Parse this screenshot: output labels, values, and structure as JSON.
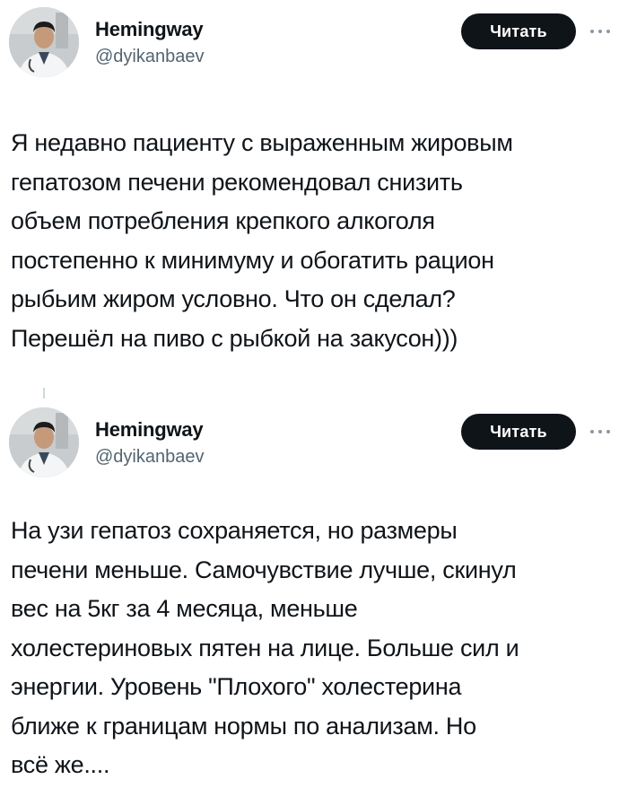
{
  "colors": {
    "text_primary": "#0f1419",
    "text_secondary": "#536471",
    "button_bg": "#0f1419",
    "button_text": "#ffffff",
    "thread_line": "#cfd9de"
  },
  "tweets": [
    {
      "author": {
        "name": "Hemingway",
        "handle": "@dyikanbaev",
        "avatar_icon": "doctor-profile-photo"
      },
      "follow_label": "Читать",
      "more_icon": "ellipsis-icon",
      "text": "Я недавно пациенту с выраженным жировым\nгепатозом печени рекомендовал снизить\nобъем потребления крепкого алкоголя\nпостепенно к минимуму и обогатить рацион\nрыбьим жиром условно. Что он сделал?\nПерешёл на пиво с рыбкой на закусон)))"
    },
    {
      "author": {
        "name": "Hemingway",
        "handle": "@dyikanbaev",
        "avatar_icon": "doctor-profile-photo"
      },
      "follow_label": "Читать",
      "more_icon": "ellipsis-icon",
      "text": "На узи гепатоз сохраняется, но размеры\nпечени меньше. Самочувствие лучше, скинул\nвес на 5кг за 4 месяца, меньше\nхолестериновых пятен на лице. Больше сил и\nэнергии. Уровень \"Плохого\" холестерина\nближе к границам нормы по анализам. Но\nвсё же...."
    }
  ]
}
